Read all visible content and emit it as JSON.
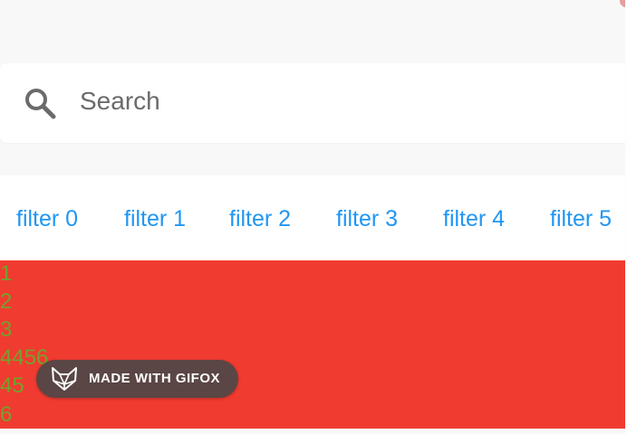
{
  "search": {
    "placeholder": "Search",
    "icon": "search-icon"
  },
  "filters": [
    {
      "label": "filter 0"
    },
    {
      "label": "filter 1"
    },
    {
      "label": "filter 2"
    },
    {
      "label": "filter 3"
    },
    {
      "label": "filter 4"
    },
    {
      "label": "filter 5"
    }
  ],
  "content": {
    "background_color": "#f03b30",
    "text_color": "#74a12d",
    "lines": [
      "1",
      "2",
      "3",
      "4456",
      "45",
      "6"
    ]
  },
  "badge": {
    "text": "MADE WITH GIFOX",
    "icon": "fox-icon"
  },
  "colors": {
    "accent": "#2196f3",
    "page_background": "#f8f8f8"
  }
}
